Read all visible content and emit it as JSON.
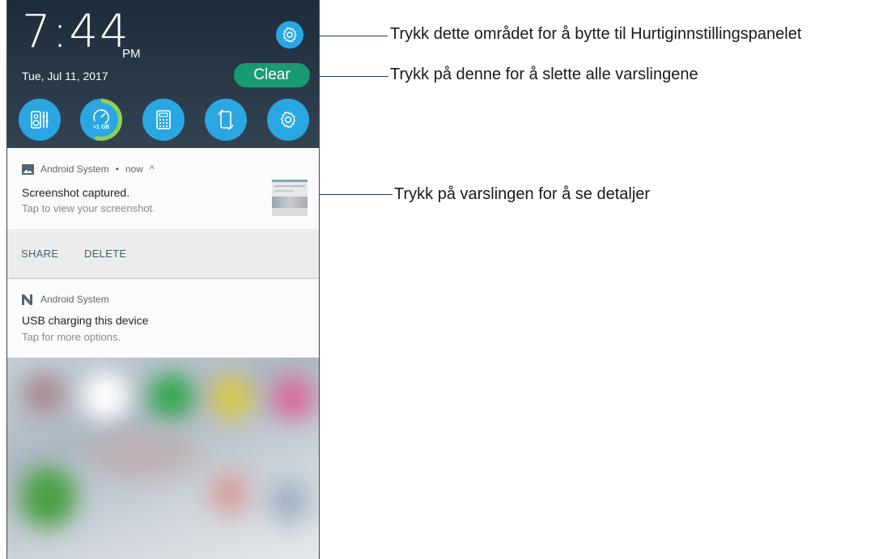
{
  "status": {
    "time": "7:44",
    "ampm": "PM",
    "date": "Tue, Jul 11, 2017"
  },
  "header": {
    "clear_label": "Clear",
    "settings_icon": "gear-icon"
  },
  "quick_settings": [
    {
      "icon": "equalizer-icon"
    },
    {
      "icon": "memory-boost-icon",
      "label": ">1 GB",
      "fill": 0.55
    },
    {
      "icon": "calculator-icon"
    },
    {
      "icon": "auto-rotate-icon"
    },
    {
      "icon": "settings-icon"
    }
  ],
  "notifications": [
    {
      "app": "Android System",
      "time": "now",
      "expand": "^",
      "title": "Screenshot captured.",
      "subtitle": "Tap to view your screenshot.",
      "actions": [
        "SHARE",
        "DELETE"
      ]
    },
    {
      "app": "Android System",
      "title": "USB charging this device",
      "subtitle": "Tap for more options."
    }
  ],
  "callouts": [
    "Trykk dette området for å bytte til Hurtiginnstillingspanelet",
    "Trykk på denne for å slette alle varslingene",
    "Trykk på varslingen for å se detaljer"
  ],
  "colors": {
    "accent": "#2aa7e3",
    "clear": "#1a9a73",
    "callout_line": "#1e3f63"
  }
}
